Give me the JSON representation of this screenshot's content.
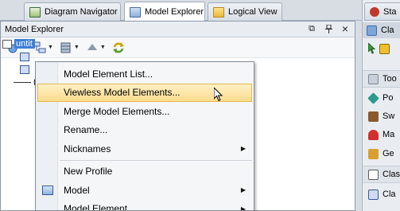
{
  "tabs": [
    {
      "label": "Diagram Navigator",
      "active": false
    },
    {
      "label": "Model Explorer",
      "active": true
    },
    {
      "label": "Logical View",
      "active": false
    }
  ],
  "panel": {
    "title": "Model Explorer",
    "buttons": {
      "restore": "⧉",
      "pin": "📌",
      "close": "×"
    }
  },
  "tree": {
    "root_label": "untit",
    "children": [
      "",
      "",
      "("
    ]
  },
  "context_menu": {
    "items": [
      {
        "label": "Model Element List...",
        "submenu": false
      },
      {
        "label": "Viewless Model Elements...",
        "submenu": false,
        "highlighted": true
      },
      {
        "label": "Merge Model Elements...",
        "submenu": false
      },
      {
        "label": "Rename...",
        "submenu": false
      },
      {
        "label": "Nicknames",
        "submenu": true
      },
      {
        "label": "New Profile",
        "submenu": false
      },
      {
        "label": "Model",
        "submenu": true
      },
      {
        "label": "Model Element",
        "submenu": true
      }
    ]
  },
  "right_panel": {
    "tab": "Sta",
    "header": "Cla",
    "rows": [
      "",
      "Too",
      "Po",
      "Sw",
      "Ma",
      "Ge",
      "Clas",
      "Cla"
    ]
  },
  "colors": {
    "selection": "#3d7fd6",
    "menu_highlight": "#fbdc8d",
    "accent": "#e5b94f"
  }
}
